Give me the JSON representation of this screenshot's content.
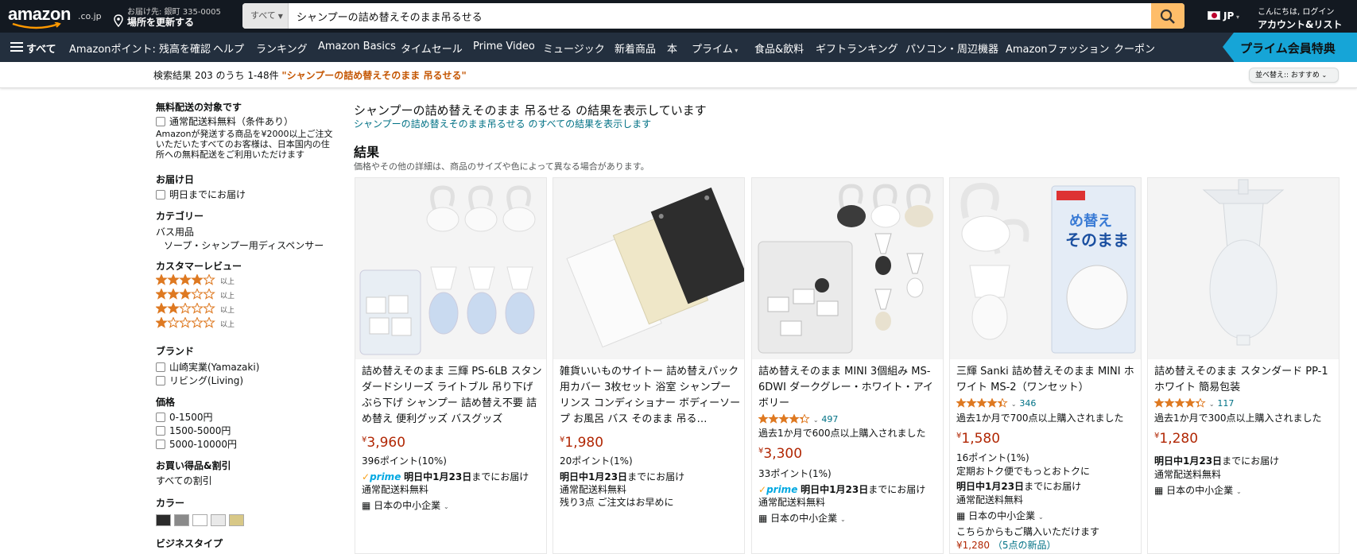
{
  "header": {
    "logo": "amazon",
    "logo_tld": ".co.jp",
    "deliver_line1": "お届け先: 銀町 335-0005",
    "deliver_line2": "場所を更新する",
    "search_category": "すべて",
    "search_value": "シャンプーの詰め替えそのまま吊るせる",
    "lang": "JP",
    "account_line1": "こんにちは, ログイン",
    "account_line2": "アカウント&リスト"
  },
  "nav": {
    "all": "すべて",
    "items": [
      "Amazonポイント: 残高を確認",
      "ヘルプ",
      "ランキング",
      "Amazon Basics",
      "タイムセール",
      "Prime Video",
      "ミュージック",
      "新着商品",
      "本",
      "プライム",
      "食品&飲料",
      "ギフトランキング",
      "パソコン・周辺機器",
      "Amazonファッション",
      "クーポン"
    ],
    "prime_promo": "プライム会員特典"
  },
  "results_bar": {
    "prefix": "検索結果 203 のうち 1-48件 ",
    "query": "\"シャンプーの詰め替えそのまま 吊るせる\"",
    "sort": "並べ替え:: おすすめ"
  },
  "sidebar": {
    "free_ship_h": "無料配送の対象です",
    "free_ship_opt": "通常配送料無料（条件あり）",
    "free_ship_note": "Amazonが発送する商品を¥2000以上ご注文いただいたすべてのお客様は、日本国内の住所への無料配送をご利用いただけます",
    "delivery_h": "お届け日",
    "delivery_opt": "明日までにお届け",
    "category_h": "カテゴリー",
    "category_1": "バス用品",
    "category_2": "ソープ・シャンプー用ディスペンサー",
    "review_h": "カスタマーレビュー",
    "review_rows": [
      {
        "stars": 4,
        "label": "以上"
      },
      {
        "stars": 3,
        "label": "以上"
      },
      {
        "stars": 2,
        "label": "以上"
      },
      {
        "stars": 1,
        "label": "以上"
      }
    ],
    "brand_h": "ブランド",
    "brands": [
      "山崎実業(Yamazaki)",
      "リビング(Living)"
    ],
    "price_h": "価格",
    "prices": [
      "0-1500円",
      "1500-5000円",
      "5000-10000円"
    ],
    "deals_h": "お買い得品&割引",
    "deals_opt": "すべての割引",
    "color_h": "カラー",
    "colors": [
      "#2b2b2b",
      "#8a8a8a",
      "#ffffff",
      "#e9e9e9",
      "#d8c887"
    ],
    "business_h": "ビジネスタイプ"
  },
  "main": {
    "showing": "シャンプーの詰め替えそのまま 吊るせる の結果を表示しています",
    "show_all": "シャンプーの詰め替えそのまま吊るせる のすべての結果を表示します",
    "results_h": "結果",
    "results_note": "価格やその他の詳細は、商品のサイズや色によって異なる場合があります。"
  },
  "products": [
    {
      "title": "詰め替えそのまま 三輝 PS-6LB スタンダードシリーズ ライトブル 吊り下げ ぶら下げ シャンプー 詰め替え不要 詰め替え 便利グッズ バスグッズ",
      "currency": "¥",
      "price": "3,960",
      "points": "396ポイント(10%)",
      "prime": "prime",
      "delivery_bold": "明日中1月23日",
      "delivery_rest": "までにお届け",
      "shipping": "通常配送料無料",
      "seller": "日本の中小企業"
    },
    {
      "title": "雑貨いいものサイトー 詰め替えパック用カバー 3枚セット 浴室 シャンプー リンス コンディショナー ボディーソープ お風呂 バス そのまま 吊る…",
      "currency": "¥",
      "price": "1,980",
      "points": "20ポイント(1%)",
      "delivery_bold": "明日中1月23日",
      "delivery_rest": "までにお届け",
      "shipping": "通常配送料無料",
      "stock": "残り3点 ご注文はお早めに"
    },
    {
      "title": "詰め替えそのまま MINI 3個組み MS-6DWI ダークグレー・ホワイト・アイボリー",
      "rating": 4.3,
      "reviews": "497",
      "bought": "過去1か月で600点以上購入されました",
      "currency": "¥",
      "price": "3,300",
      "points": "33ポイント(1%)",
      "prime": "prime",
      "delivery_bold": "明日中1月23日",
      "delivery_rest": "までにお届け",
      "shipping": "通常配送料無料",
      "seller": "日本の中小企業"
    },
    {
      "title": "三輝 Sanki 詰め替えそのまま MINI ホワイト MS-2（ワンセット）",
      "rating": 4.4,
      "reviews": "346",
      "bought": "過去1か月で700点以上購入されました",
      "currency": "¥",
      "price": "1,580",
      "points": "16ポイント(1%)",
      "subscribe": "定期おトク便でもっとおトクに",
      "delivery_bold": "明日中1月23日",
      "delivery_rest": "までにお届け",
      "shipping": "通常配送料無料",
      "seller": "日本の中小企業",
      "other": "こちらからもご購入いただけます",
      "other_price": "¥1,280",
      "other_new": "（5点の新品）"
    },
    {
      "title": "詰め替えそのまま スタンダード PP-1 ホワイト 簡易包装",
      "rating": 4.3,
      "reviews": "117",
      "bought": "過去1か月で300点以上購入されました",
      "currency": "¥",
      "price": "1,280",
      "delivery_bold": "明日中1月23日",
      "delivery_rest": "までにお届け",
      "shipping": "通常配送料無料",
      "seller": "日本の中小企業"
    }
  ]
}
